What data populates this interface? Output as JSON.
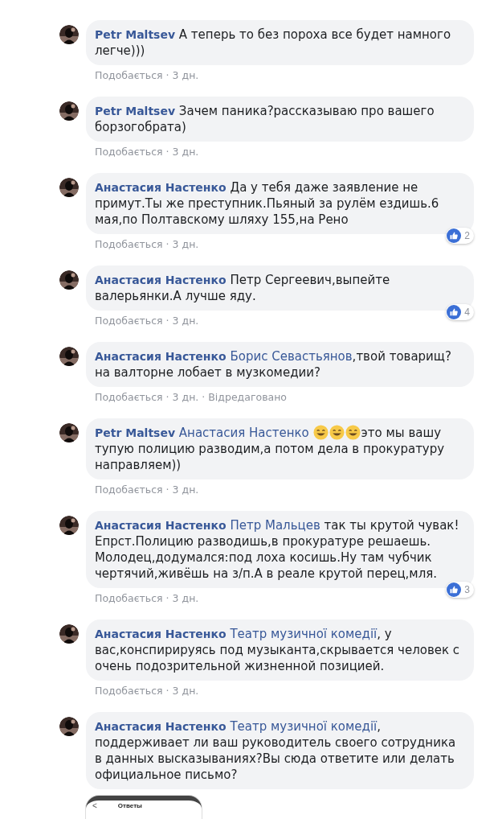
{
  "comments": [
    {
      "author": "Petr Maltsev",
      "avatar": {
        "kind": "picture"
      },
      "parts": [
        {
          "kind": "text",
          "text": "А теперь то без пороха все будет намного легче)))"
        }
      ],
      "meta": [
        "Подобається",
        "·",
        "3 дн."
      ]
    },
    {
      "author": "Petr Maltsev",
      "avatar": {
        "kind": "picture"
      },
      "parts": [
        {
          "kind": "text",
          "text": "Зачем паника?рассказываю про вашего борзогобрата)"
        }
      ],
      "meta": [
        "Подобається",
        "·",
        "3 дн."
      ]
    },
    {
      "author": "Анастасия Настенко",
      "avatar": {
        "kind": "picture"
      },
      "parts": [
        {
          "kind": "text",
          "text": "Да у тебя даже заявление не примут.Ты же преступник.Пьяный за рулём ездишь.6 мая,по Полтавскому шляху 155,на Рено"
        }
      ],
      "meta": [
        "Подобається",
        "·",
        "3 дн."
      ],
      "reactions": {
        "count": "2"
      }
    },
    {
      "author": "Анастасия Настенко",
      "avatar": {
        "kind": "picture"
      },
      "parts": [
        {
          "kind": "text",
          "text": "Петр Сергеевич,выпейте валерьянки.А лучше яду."
        }
      ],
      "meta": [
        "Подобається",
        "·",
        "3 дн."
      ],
      "reactions": {
        "count": "4"
      }
    },
    {
      "author": "Анастасия Настенко",
      "avatar": {
        "kind": "picture"
      },
      "parts": [
        {
          "kind": "mention",
          "text": "Борис Севастьянов"
        },
        {
          "kind": "text",
          "text": ",твой товарищ?на валторне лобает в музкомедии?"
        }
      ],
      "meta": [
        "Подобається",
        "·",
        "3 дн.",
        "·",
        "Відредаговано"
      ]
    },
    {
      "author": "Petr Maltsev",
      "avatar": {
        "kind": "picture"
      },
      "parts": [
        {
          "kind": "mention",
          "text": "Анастасия Настенко"
        },
        {
          "kind": "emoji"
        },
        {
          "kind": "emoji"
        },
        {
          "kind": "emoji"
        },
        {
          "kind": "text",
          "text": "это мы вашу тупую полицию разводим,а потом дела в прокуратуру направляем))"
        }
      ],
      "meta": [
        "Подобається",
        "·",
        "3 дн."
      ]
    },
    {
      "author": "Анастасия Настенко",
      "avatar": {
        "kind": "picture"
      },
      "parts": [
        {
          "kind": "mention",
          "text": "Петр Мальцев"
        },
        {
          "kind": "text",
          "text": " так ты крутой чувак! Епрст.Полицию разводишь,в прокуратуре решаешь. Молодец,додумался:под лоха косишь.Ну там чубчик чертячий,живёшь на з/п.А в реале крутой перец,мля."
        }
      ],
      "meta": [
        "Подобається",
        "·",
        "3 дн."
      ],
      "reactions": {
        "count": "3"
      }
    },
    {
      "author": "Анастасия Настенко",
      "avatar": {
        "kind": "picture"
      },
      "parts": [
        {
          "kind": "mention",
          "text": "Театр музичної комедії"
        },
        {
          "kind": "text",
          "text": ", у вас,конспирируясь под музыканта,скрывается человек с очень подозрительной жизненной позицией."
        }
      ],
      "meta": [
        "Подобається",
        "·",
        "3 дн."
      ]
    },
    {
      "author": "Анастасия Настенко",
      "avatar": {
        "kind": "picture"
      },
      "parts": [
        {
          "kind": "mention",
          "text": "Театр музичної комедії"
        },
        {
          "kind": "text",
          "text": ", поддерживает ли ваш руководитель своего сотрудника в данных высказываниях?Вы сюда ответите или делать официальное письмо?"
        }
      ],
      "attachment": {
        "back": "<",
        "title": "Ответы"
      }
    }
  ]
}
